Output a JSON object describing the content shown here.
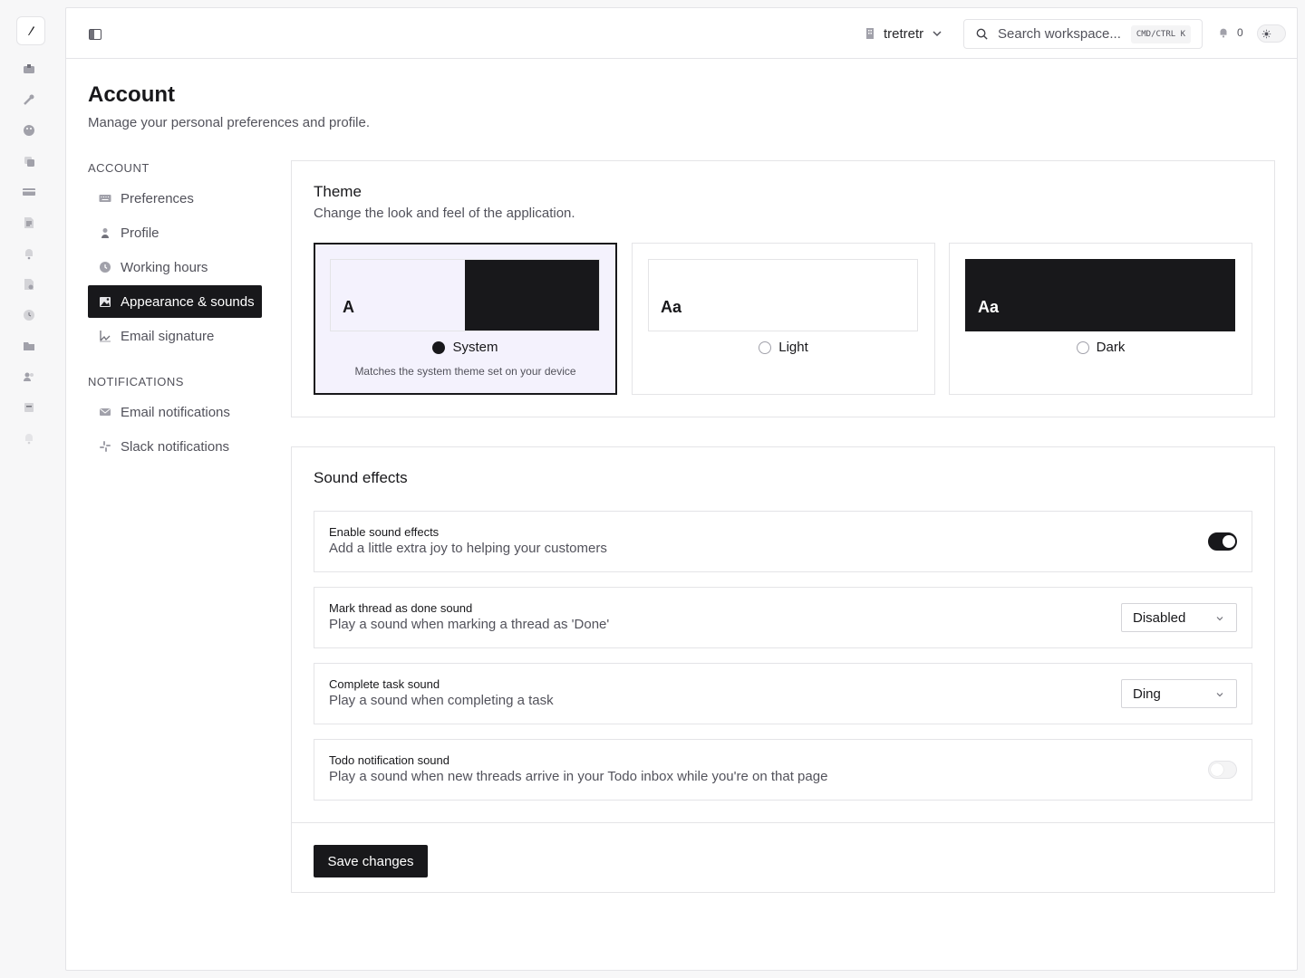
{
  "topbar": {
    "workspace_name": "tretretr",
    "search_placeholder": "Search workspace...",
    "search_shortcut": "CMD/CTRL K",
    "notification_count": "0"
  },
  "page": {
    "title": "Account",
    "subtitle": "Manage your personal preferences and profile."
  },
  "nav": {
    "account_section": "ACCOUNT",
    "account_items": [
      {
        "label": "Preferences",
        "icon": "keyboard-icon"
      },
      {
        "label": "Profile",
        "icon": "user-icon"
      },
      {
        "label": "Working hours",
        "icon": "clock-icon"
      },
      {
        "label": "Appearance & sounds",
        "icon": "image-icon",
        "active": true
      },
      {
        "label": "Email signature",
        "icon": "signature-icon"
      }
    ],
    "notifications_section": "NOTIFICATIONS",
    "notification_items": [
      {
        "label": "Email notifications",
        "icon": "mail-icon"
      },
      {
        "label": "Slack notifications",
        "icon": "slack-icon"
      }
    ]
  },
  "theme": {
    "title": "Theme",
    "subtitle": "Change the look and feel of the application.",
    "options": [
      {
        "label": "System",
        "glyph": "A",
        "selected": true,
        "description": "Matches the system theme set on your device"
      },
      {
        "label": "Light",
        "glyph": "Aa",
        "selected": false
      },
      {
        "label": "Dark",
        "glyph": "Aa",
        "selected": false
      }
    ]
  },
  "sound": {
    "title": "Sound effects",
    "rows": [
      {
        "label": "Enable sound effects",
        "description": "Add a little extra joy to helping your customers",
        "control": "switch",
        "on": true
      },
      {
        "label": "Mark thread as done sound",
        "description": "Play a sound when marking a thread as 'Done'",
        "control": "select",
        "value": "Disabled"
      },
      {
        "label": "Complete task sound",
        "description": "Play a sound when completing a task",
        "control": "select",
        "value": "Ding"
      },
      {
        "label": "Todo notification sound",
        "description": "Play a sound when new threads arrive in your Todo inbox while you're on that page",
        "control": "switch",
        "on": false
      }
    ],
    "save_label": "Save changes"
  },
  "colors": {
    "accent": "#18181b",
    "selected_bg": "#f4f2fd",
    "border": "#e4e4e7",
    "muted_text": "#52525b"
  }
}
